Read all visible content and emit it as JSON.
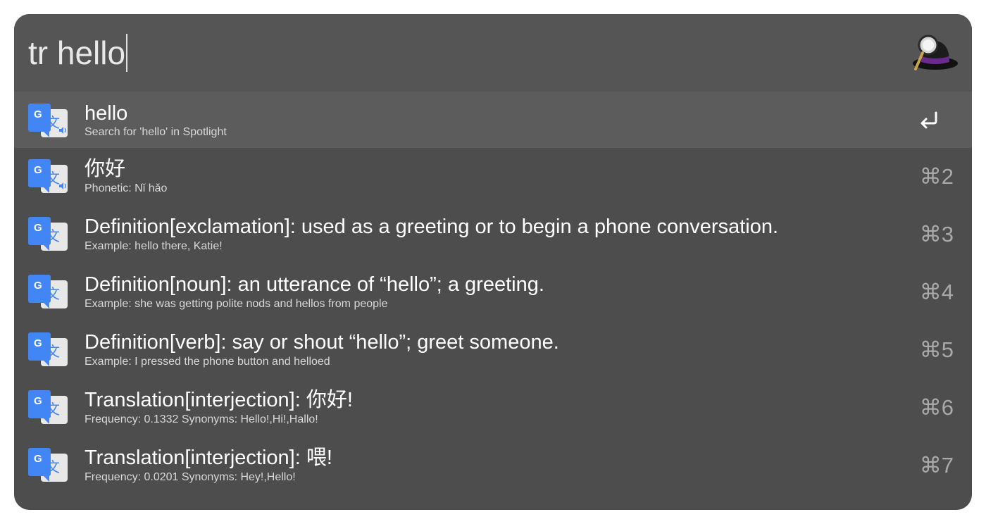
{
  "search": {
    "query": "tr hello"
  },
  "app_icon": "alfred-hat-icon",
  "results": [
    {
      "title": "hello",
      "subtitle": "Search for 'hello' in Spotlight",
      "shortcut": "",
      "icon": "google-translate-speaker-icon",
      "selected": true
    },
    {
      "title": "你好",
      "subtitle": "Phonetic: Nǐ hǎo",
      "shortcut": "⌘2",
      "icon": "google-translate-speaker-icon"
    },
    {
      "title": "Definition[exclamation]: used as a greeting or to begin a phone conversation.",
      "subtitle": "Example: hello there, Katie!",
      "shortcut": "⌘3",
      "icon": "google-translate-icon"
    },
    {
      "title": "Definition[noun]: an utterance of “hello”; a greeting.",
      "subtitle": "Example: she was getting polite nods and hellos from people",
      "shortcut": "⌘4",
      "icon": "google-translate-icon"
    },
    {
      "title": "Definition[verb]: say or shout “hello”; greet someone.",
      "subtitle": "Example: I pressed the phone button and helloed",
      "shortcut": "⌘5",
      "icon": "google-translate-icon"
    },
    {
      "title": "Translation[interjection]: 你好!",
      "subtitle": "Frequency: 0.1332 Synonyms: Hello!,Hi!,Hallo!",
      "shortcut": "⌘6",
      "icon": "google-translate-icon"
    },
    {
      "title": "Translation[interjection]: 喂!",
      "subtitle": "Frequency: 0.0201 Synonyms: Hey!,Hello!",
      "shortcut": "⌘7",
      "icon": "google-translate-icon"
    }
  ],
  "colors": {
    "window_bg": "#4d4d4d",
    "search_bg": "#555555",
    "selected_row_bg": "#5c5c5c",
    "google_blue": "#4285f4",
    "icon_light": "#e8e8e8"
  }
}
